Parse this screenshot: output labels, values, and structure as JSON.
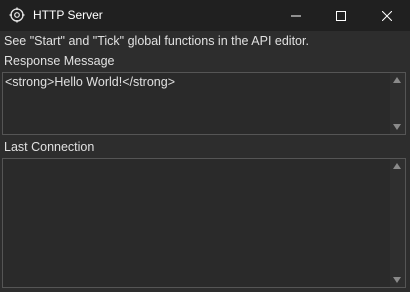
{
  "window": {
    "title": "HTTP Server",
    "icon": "gear-globe-icon",
    "controls": [
      "minimize-icon",
      "maximize-icon",
      "close-icon"
    ]
  },
  "hint_text": "See \"Start\" and \"Tick\" global functions in the API editor.",
  "response": {
    "label": "Response Message",
    "value": "<strong>Hello World!</strong>"
  },
  "last_connection": {
    "label": "Last Connection",
    "value": ""
  },
  "colors": {
    "titlebar": "#202020",
    "background": "#2d2d2d",
    "field": "#2a2a2a",
    "text": "#e0e0e0"
  }
}
